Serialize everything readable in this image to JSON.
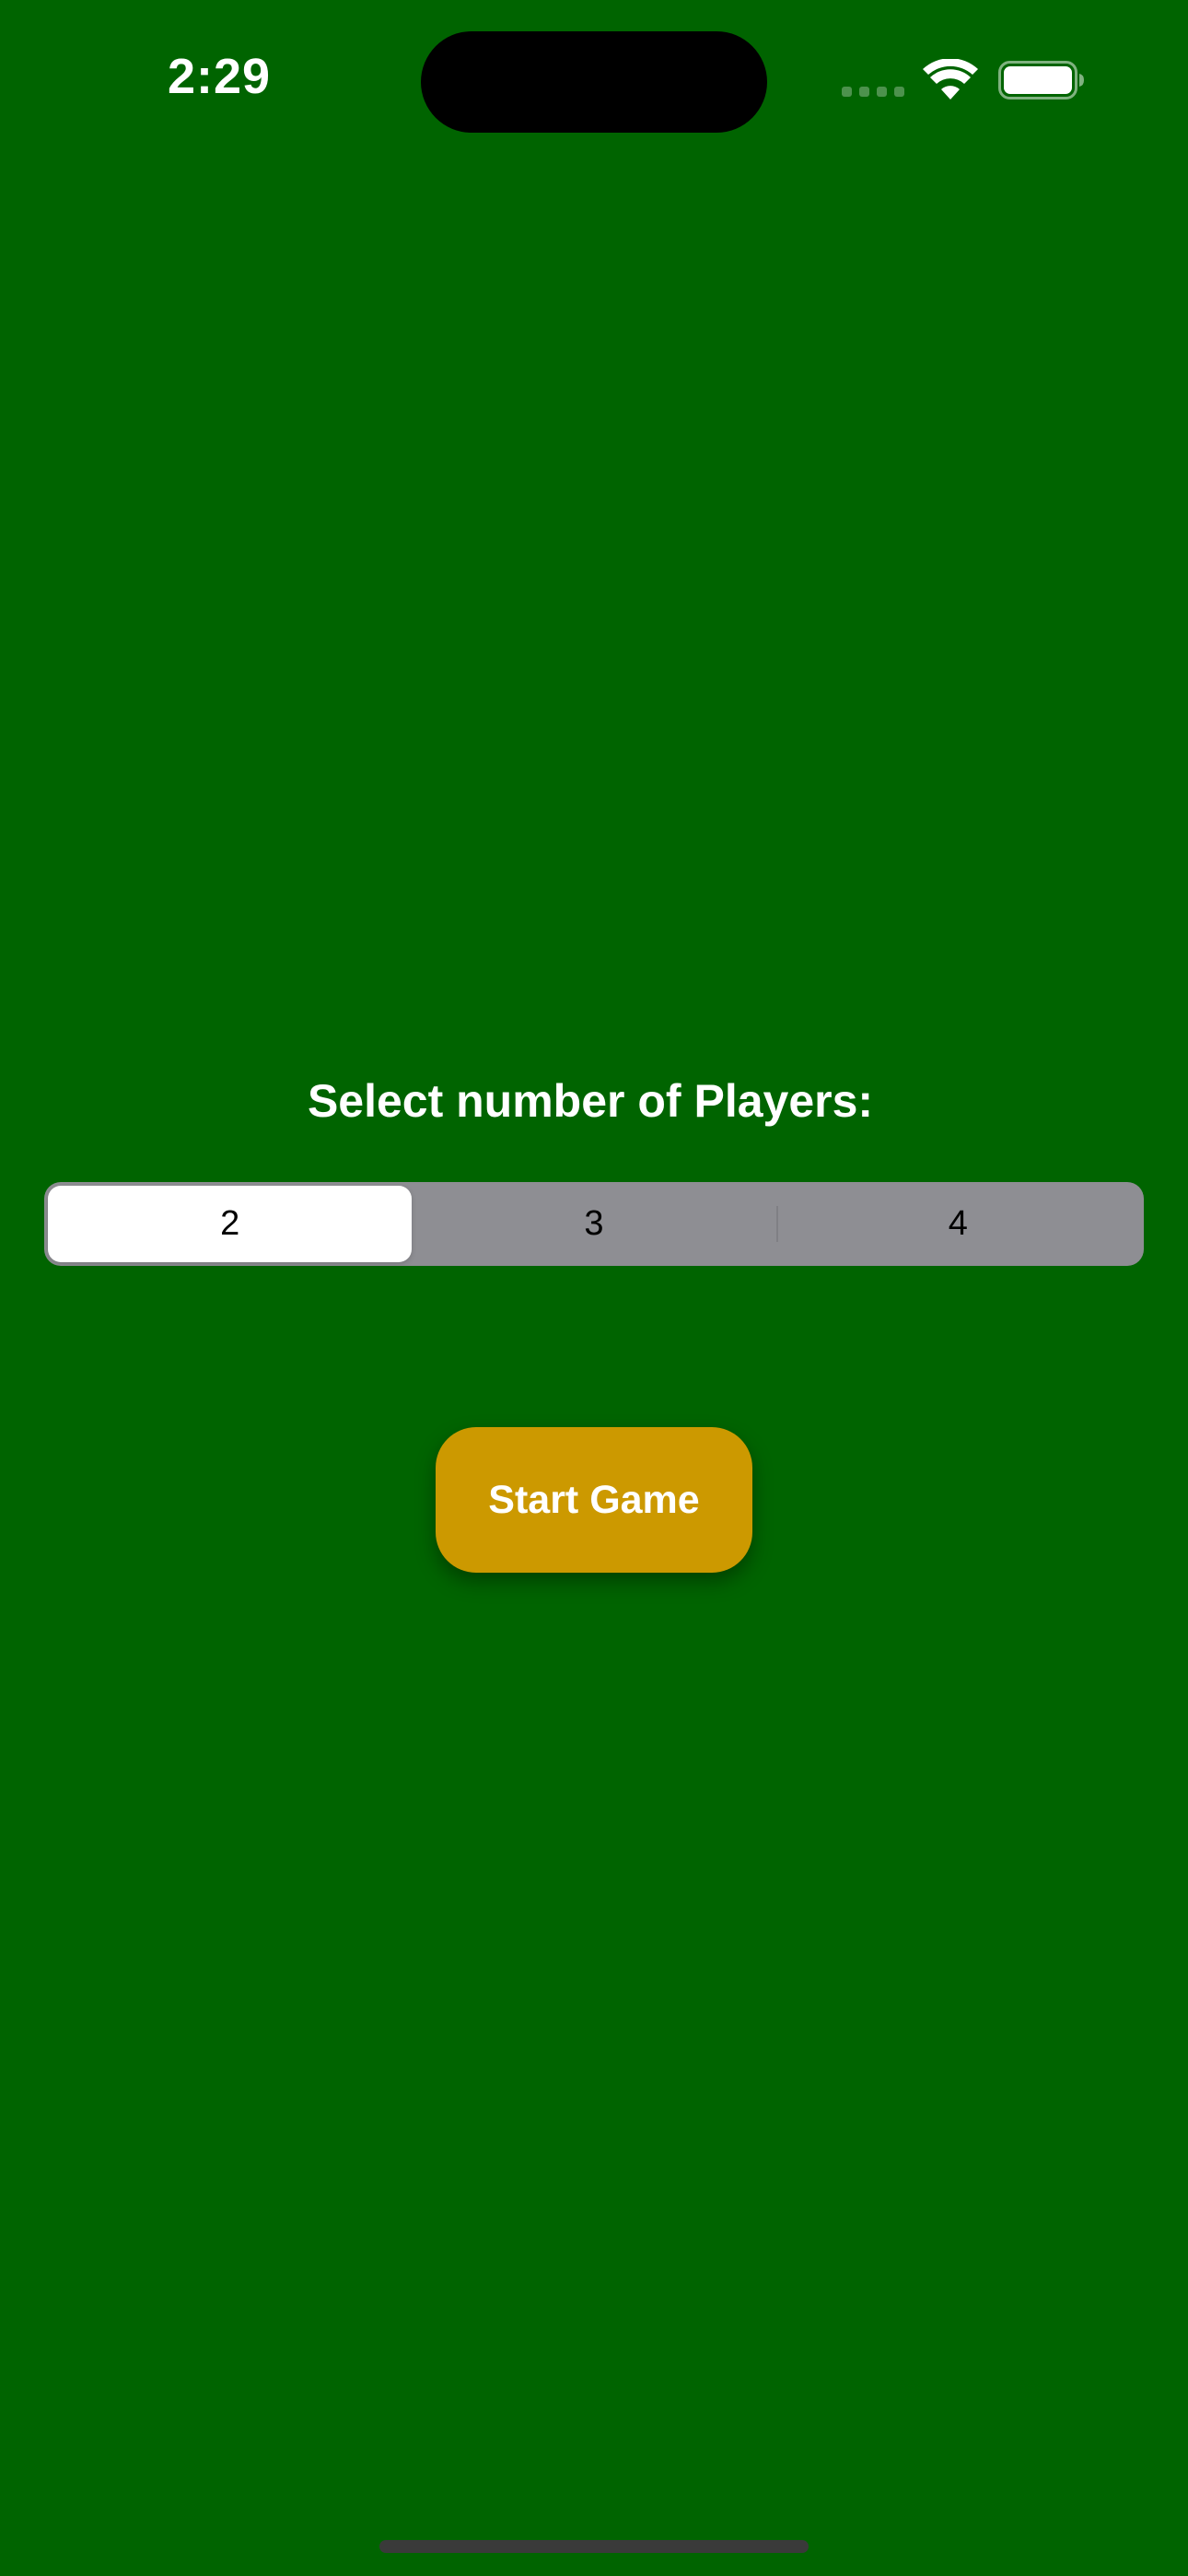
{
  "status_bar": {
    "time": "2:29",
    "icons": [
      "cellular-signal-icon",
      "wifi-icon",
      "battery-icon"
    ]
  },
  "colors": {
    "background": "#006400",
    "segment_track": "#8e8e93",
    "segment_selected": "#ffffff",
    "button": "#cc9900",
    "text": "#ffffff"
  },
  "main": {
    "title": "Select number of Players:",
    "player_options": [
      "2",
      "3",
      "4"
    ],
    "selected_option": "2",
    "start_button_label": "Start Game"
  }
}
